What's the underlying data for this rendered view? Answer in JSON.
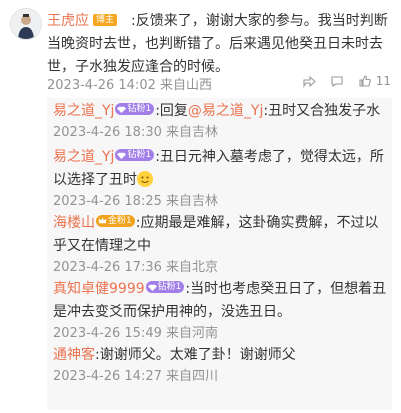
{
  "main_comment": {
    "username": "王虎应",
    "badge": "博主",
    "text": ":反馈来了，谢谢大家的参与。我当时判断当晚资时去世，也判断错了。后来遇见他癸丑日未时去世，子水独发应逢合的时候。",
    "meta": "2023-4-26 14:02 来自山西",
    "like_count": "11"
  },
  "replies": [
    {
      "username": "易之道_Yj",
      "badge": "钻粉1",
      "badge_color": "#a17ee8",
      "text_prefix": ":回复",
      "mention": "@易之道_Yj",
      "text": ":丑时又合独发子水",
      "meta": "2023-4-26 18:30 来自吉林"
    },
    {
      "username": "易之道_Yj",
      "badge": "钻粉1",
      "badge_color": "#a17ee8",
      "text": ":丑日元神入墓考虑了，觉得太远，所以选择了丑时",
      "emoji": "smiling-face",
      "meta": "2023-4-26 18:25 来自吉林"
    },
    {
      "username": "海楼山",
      "badge": "金粉1",
      "badge_color": "#f0a31b",
      "text": ":应期最是难解，这卦确实费解，不过以乎又在情理之中",
      "meta": "2023-4-26 17:36 来自北京"
    },
    {
      "username": "真知卓健9999",
      "badge": "钻粉1",
      "badge_color": "#a17ee8",
      "text": ":当时也考虑癸丑日了，但想着丑是冲去变爻而保护用神的，没选丑日。",
      "meta": "2023-4-26 15:49 来自河南"
    },
    {
      "username": "通神客",
      "text": ":谢谢师父。太难了卦！谢谢师父",
      "meta": "2023-4-26 14:27 来自四川"
    }
  ],
  "colors": {
    "username": "#eb7350",
    "meta": "#939393",
    "reply_bg": "#f7f7f7"
  }
}
